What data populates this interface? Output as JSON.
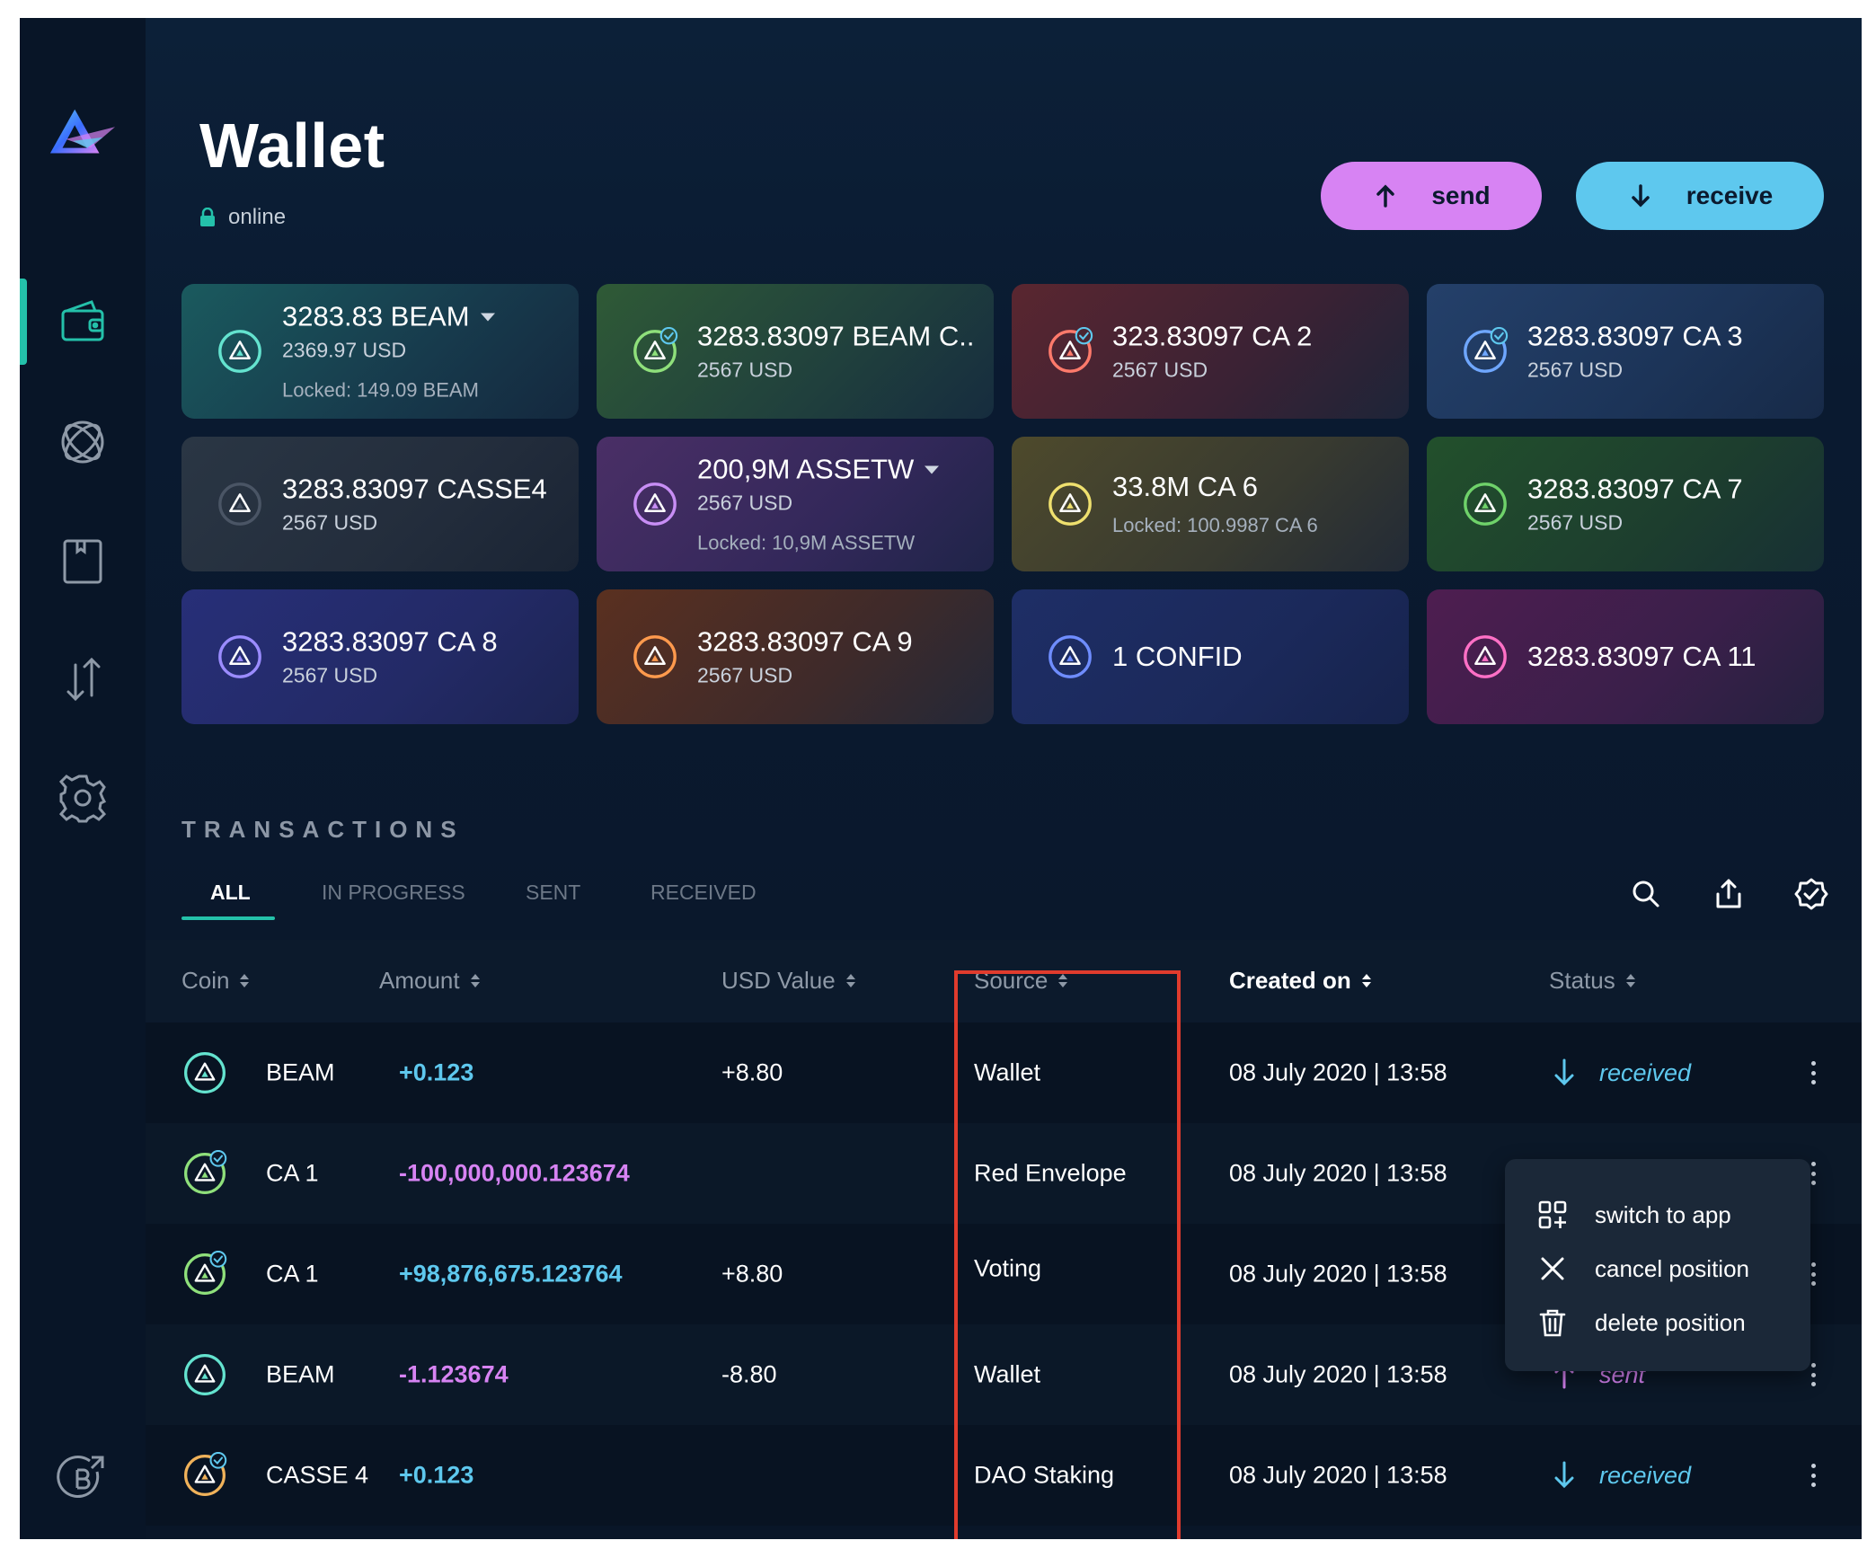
{
  "window": {
    "traffic_lights": [
      "close",
      "minimize",
      "zoom"
    ]
  },
  "sidebar": {
    "logo_icon": "beam-logo-icon",
    "items": [
      {
        "name": "wallet",
        "icon": "wallet-icon",
        "active": true
      },
      {
        "name": "dapps",
        "icon": "atom-icon",
        "active": false
      },
      {
        "name": "addresses",
        "icon": "address-book-icon",
        "active": false
      },
      {
        "name": "transactions",
        "icon": "swap-arrows-icon",
        "active": false
      },
      {
        "name": "settings",
        "icon": "gear-icon",
        "active": false
      }
    ],
    "bottom_icon": "beam-external-link-icon"
  },
  "header": {
    "title": "Wallet",
    "status": "online",
    "send_label": "send",
    "receive_label": "receive"
  },
  "assets": [
    {
      "amount": "3283.83 BEAM",
      "usd": "2369.97 USD",
      "locked": "Locked: 149.09 BEAM",
      "dropdown": true,
      "verified": false,
      "color": "#64e3cf"
    },
    {
      "amount": "3283.83097 BEAM C..",
      "usd": "2567 USD",
      "locked": "",
      "dropdown": false,
      "verified": true,
      "color": "#8fe07b"
    },
    {
      "amount": "323.83097 CA 2",
      "usd": "2567 USD",
      "locked": "",
      "dropdown": false,
      "verified": true,
      "color": "#ff7a6b"
    },
    {
      "amount": "3283.83097 CA 3",
      "usd": "2567 USD",
      "locked": "",
      "dropdown": false,
      "verified": true,
      "color": "#6fa7ff"
    },
    {
      "amount": "3283.83097 CASSE4",
      "usd": "2567 USD",
      "locked": "",
      "dropdown": false,
      "verified": false,
      "color": "#4a5565"
    },
    {
      "amount": "200,9M ASSETW",
      "usd": "2567 USD",
      "locked": "Locked: 10,9M ASSETW",
      "dropdown": true,
      "verified": false,
      "color": "#c88ef5"
    },
    {
      "amount": "33.8M CA 6",
      "usd": "",
      "locked": "Locked: 100.9987 CA 6",
      "dropdown": false,
      "verified": false,
      "color": "#efe06e"
    },
    {
      "amount": "3283.83097 CA 7",
      "usd": "2567 USD",
      "locked": "",
      "dropdown": false,
      "verified": false,
      "color": "#6fd26a"
    },
    {
      "amount": "3283.83097 CA 8",
      "usd": "2567 USD",
      "locked": "",
      "dropdown": false,
      "verified": false,
      "color": "#9b8cff"
    },
    {
      "amount": "3283.83097 CA 9",
      "usd": "2567 USD",
      "locked": "",
      "dropdown": false,
      "verified": false,
      "color": "#ff9a4d"
    },
    {
      "amount": "1 CONFID",
      "usd": "",
      "locked": "",
      "dropdown": false,
      "verified": false,
      "color": "#6f8dff"
    },
    {
      "amount": "3283.83097 CA 11",
      "usd": "",
      "locked": "",
      "dropdown": false,
      "verified": false,
      "color": "#ff70c6"
    }
  ],
  "transactions": {
    "title": "TRANSACTIONS",
    "tabs": [
      "ALL",
      "IN PROGRESS",
      "SENT",
      "RECEIVED"
    ],
    "active_tab": "ALL",
    "tools": [
      "search-icon",
      "export-icon",
      "verified-badge-icon"
    ],
    "columns": [
      "Coin",
      "Amount",
      "USD Value",
      "Source",
      "Created on",
      "Status"
    ],
    "rows": [
      {
        "coin": "BEAM",
        "amount": "+0.123",
        "usd": "+8.80",
        "source": "Wallet",
        "created": "08 July 2020  | 13:58",
        "status": "received",
        "sign": "pos",
        "verified": false,
        "coin_color": "#64e3cf"
      },
      {
        "coin": "CA 1",
        "amount": "-100,000,000.123674",
        "usd": "",
        "source": "Red Envelope",
        "created": "08 July 2020  | 13:58",
        "status": "",
        "sign": "neg",
        "verified": true,
        "coin_color": "#8fe07b"
      },
      {
        "coin": "CA 1",
        "amount": "+98,876,675.123764",
        "usd": "+8.80",
        "source": "Voting",
        "created": "08 July 2020  | 13:58",
        "status": "",
        "sign": "pos",
        "verified": true,
        "coin_color": "#8fe07b"
      },
      {
        "coin": "BEAM",
        "amount": "-1.123674",
        "usd": "-8.80",
        "source": "Wallet",
        "created": "08 July 2020  | 13:58",
        "status": "sent",
        "sign": "neg",
        "verified": false,
        "coin_color": "#64e3cf"
      },
      {
        "coin": "CASSE 4",
        "amount": "+0.123",
        "usd": "",
        "source": "DAO Staking",
        "created": "08 July 2020  | 13:58",
        "status": "received",
        "sign": "pos",
        "verified": true,
        "coin_color": "#f0b25a"
      }
    ]
  },
  "context_menu": {
    "items": [
      {
        "label": "switch to app",
        "icon": "apps-plus-icon"
      },
      {
        "label": "cancel position",
        "icon": "close-icon"
      },
      {
        "label": "delete position",
        "icon": "trash-icon"
      }
    ]
  },
  "colors": {
    "accent": "#24c1aa",
    "send": "#d783f3",
    "receive": "#5ec8ee",
    "highlight": "#e03b2d"
  }
}
